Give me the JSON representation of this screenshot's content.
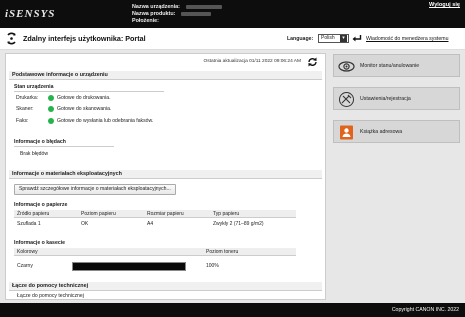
{
  "header": {
    "logo_text": "iSENSYS",
    "device_name_label": "Nazwa urządzenia:",
    "product_name_label": "Nazwa produktu:",
    "location_label": "Położenie:",
    "logout": "Wyloguj się"
  },
  "titlebar": {
    "title": "Zdalny interfejs użytkownika: Portal",
    "language_label": "Language:",
    "language_value": "Polish",
    "admin_message": "Wiadomość do menedżera systemu"
  },
  "main": {
    "last_update": "Ostatnia aktualizacja 01/11 2022 09:06:24 AM",
    "basic_info": {
      "heading": "Podstawowe informacje o urządzeniu",
      "device_status_heading": "Stan urządzenia",
      "statuses": [
        {
          "label": "Drukarka:",
          "text": "Gotowe do drukowania."
        },
        {
          "label": "Skaner:",
          "text": "Gotowe do skanowania."
        },
        {
          "label": "Faks:",
          "text": "Gotowe do wysłania lub odebrania faksów."
        }
      ],
      "errors_heading": "Informacje o błędach",
      "errors_text": "Brak błędów"
    },
    "consumables": {
      "heading": "Informacje o materiałach eksploatacyjnych",
      "details_button": "Sprawdź szczegółowe informacje o materiałach eksploatacyjnych...",
      "paper_heading": "Informacje o papierze",
      "paper_columns": [
        "Źródło papieru",
        "Poziom papieru",
        "Rozmiar papieru",
        "Typ papieru"
      ],
      "paper_rows": [
        [
          "Szuflada 1",
          "OK",
          "A4",
          "Zwykły 2 (71–89 g/m2)"
        ]
      ],
      "cartridge_heading": "Informacje o kasecie",
      "cartridge_columns": [
        "Kolorowy",
        "Poziom toneru"
      ],
      "cartridge_rows": [
        {
          "color": "Czarny",
          "level_text": "100%",
          "level": 1.0
        }
      ]
    },
    "support": {
      "heading": "Łącze do pomocy technicznej",
      "text": "Łącze do pomocy technicznej"
    }
  },
  "side_menu": [
    {
      "label": "Monitor stanu/anulowanie",
      "icon": "monitor-eye-icon"
    },
    {
      "label": "Ustawienia/rejestracja",
      "icon": "settings-icon"
    },
    {
      "label": "Książka adresowa",
      "icon": "address-book-icon"
    }
  ],
  "footer": {
    "copyright": "Copyright CANON INC. 2022"
  },
  "colors": {
    "header_bg": "#0d0d0d",
    "status_ok": "#25b34b",
    "address_book_orange": "#e0641e"
  }
}
